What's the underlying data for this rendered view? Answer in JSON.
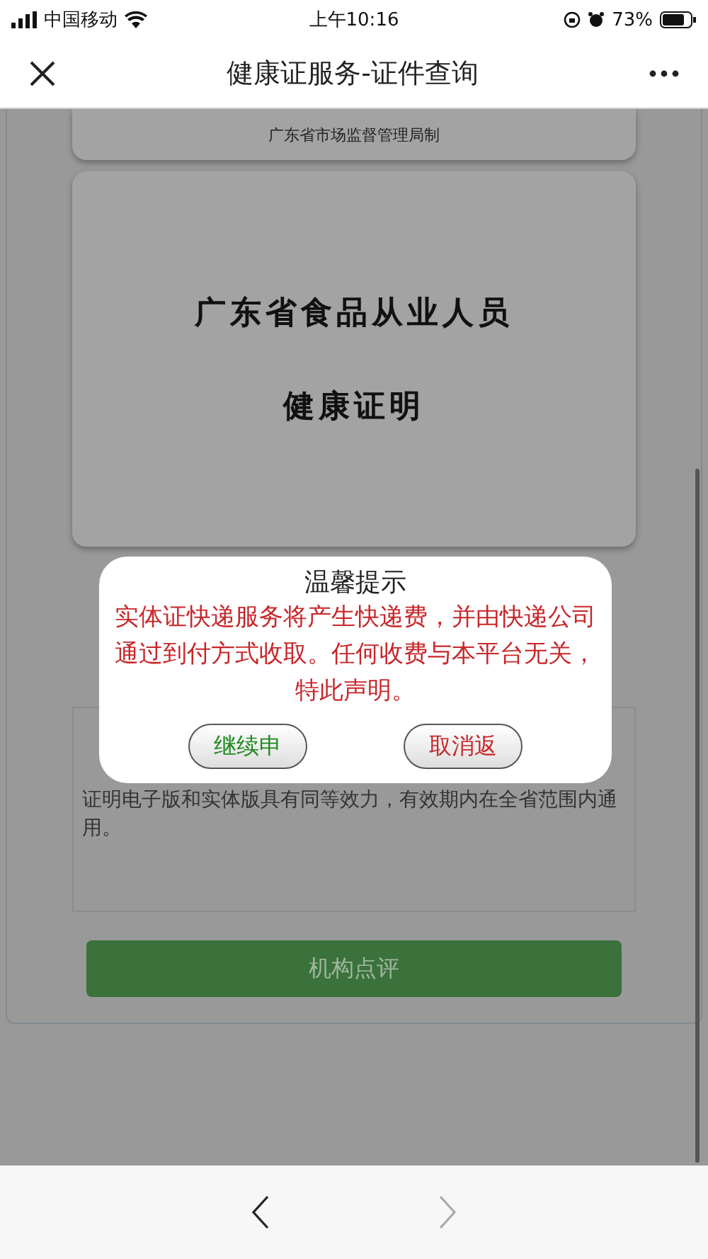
{
  "status_bar": {
    "carrier": "中国移动",
    "time": "上午10:16",
    "battery": "73%"
  },
  "nav_bar": {
    "title": "健康证服务-证件查询"
  },
  "issuer_card": {
    "text": "广东省市场监督管理局制"
  },
  "certificate_card": {
    "lines": [
      "广东省食品从业人员",
      "健康证明"
    ]
  },
  "notice": {
    "text": "证明电子版和实体版具有同等效力，有效期内在全省范围内通用。"
  },
  "review_button": {
    "label": "机构点评"
  },
  "dialog": {
    "title": "温馨提示",
    "message": "实体证快递服务将产生快递费，并由快递公司通过到付方式收取。任何收费与本平台无关，特此声明。",
    "buttons": [
      {
        "label": "继续申",
        "kind": "confirm"
      },
      {
        "label": "取消返",
        "kind": "cancel"
      }
    ]
  },
  "browser_nav": [
    {
      "kind": "back",
      "disabled": false
    },
    {
      "kind": "forward",
      "disabled": true
    }
  ]
}
